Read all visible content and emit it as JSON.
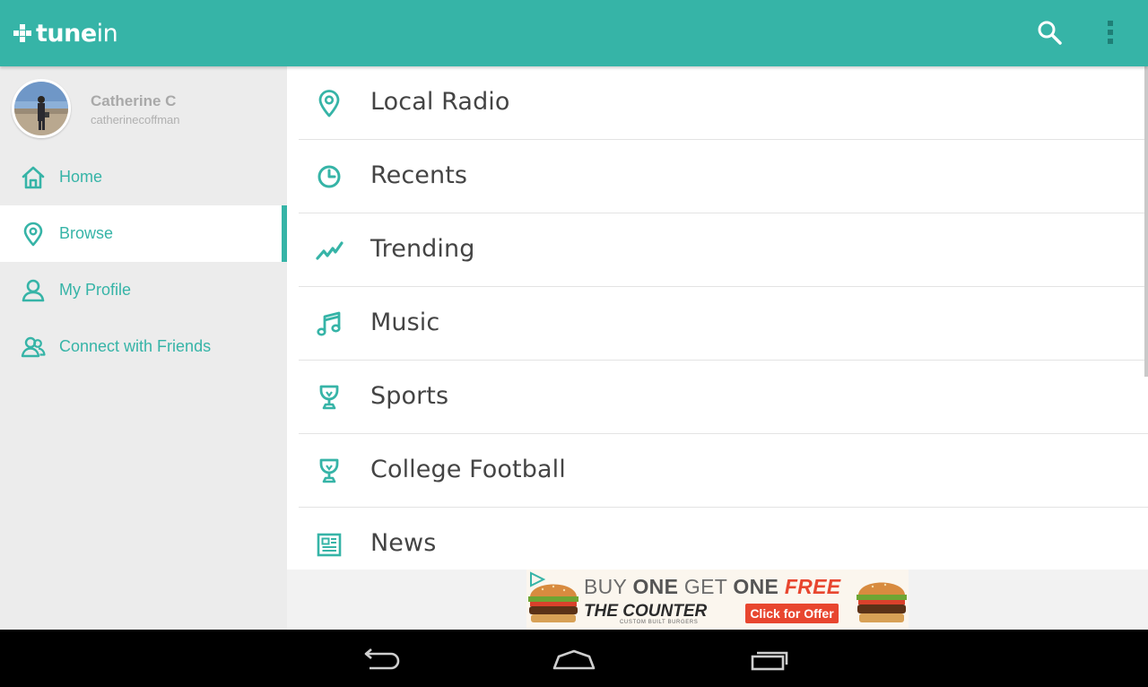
{
  "app": {
    "brand": {
      "prefix": "tune",
      "suffix": "in"
    },
    "accent_color": "#36b4a7",
    "topbar": {
      "search_icon": "search-icon",
      "overflow_icon": "more-vert-icon"
    }
  },
  "profile": {
    "name": "Catherine C",
    "username": "catherinecoffman"
  },
  "sidebar": {
    "items": [
      {
        "label": "Home",
        "icon": "home-icon",
        "active": false
      },
      {
        "label": "Browse",
        "icon": "location-pin-icon",
        "active": true
      },
      {
        "label": "My Profile",
        "icon": "person-icon",
        "active": false
      },
      {
        "label": "Connect with Friends",
        "icon": "friends-icon",
        "active": false
      }
    ]
  },
  "browse": {
    "items": [
      {
        "label": "Local Radio",
        "icon": "location-pin-icon"
      },
      {
        "label": "Recents",
        "icon": "clock-icon"
      },
      {
        "label": "Trending",
        "icon": "trending-icon"
      },
      {
        "label": "Music",
        "icon": "music-note-icon"
      },
      {
        "label": "Sports",
        "icon": "trophy-icon"
      },
      {
        "label": "College Football",
        "icon": "trophy-icon"
      },
      {
        "label": "News",
        "icon": "newspaper-icon"
      }
    ]
  },
  "ad": {
    "headline_a": "BUY ",
    "headline_b": "ONE",
    "headline_c": " GET ",
    "headline_d": "ONE",
    "headline_e": " FREE",
    "brand": "THE COUNTER",
    "tagline": "CUSTOM BUILT BURGERS",
    "cta": "Click for Offer"
  },
  "system_nav": {
    "back_icon": "back-icon",
    "home_icon": "home-outline-icon",
    "recents_icon": "recent-apps-icon"
  }
}
